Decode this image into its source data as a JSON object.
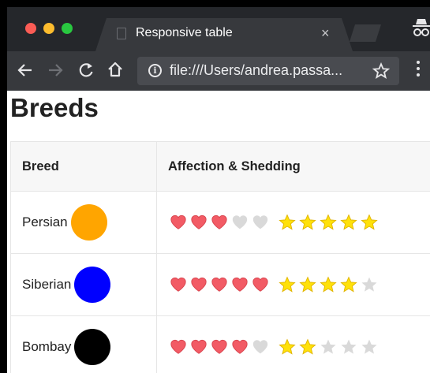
{
  "browser": {
    "tab_title": "Responsive table",
    "tab_close": "×",
    "url": "file:///Users/andrea.passa...",
    "icons": [
      "back-arrow-icon",
      "forward-arrow-icon",
      "reload-icon",
      "home-icon",
      "info-icon",
      "star-bookmark-icon",
      "menu-icon",
      "incognito-icon"
    ]
  },
  "page": {
    "title": "Breeds",
    "table": {
      "headers": [
        "Breed",
        "Affection & Shedding"
      ],
      "rows": [
        {
          "breed": "Persian",
          "color": "#ffa500",
          "affection": 3,
          "shedding": 5
        },
        {
          "breed": "Siberian",
          "color": "#0000ff",
          "affection": 5,
          "shedding": 4
        },
        {
          "breed": "Bombay",
          "color": "#000000",
          "affection": 4,
          "shedding": 2
        }
      ],
      "max_rating": 5
    }
  },
  "colors": {
    "heart_on": "#f25b65",
    "heart_off": "#d9d9d9",
    "star_on": "#ffe10a",
    "star_off": "#d9d9d9"
  }
}
